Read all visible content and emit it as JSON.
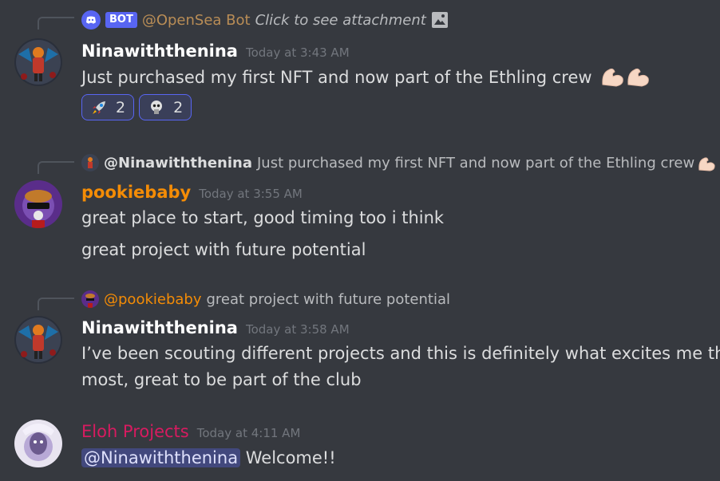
{
  "messages": [
    {
      "reply": {
        "bot_tag": "BOT",
        "author": "@OpenSea Bot",
        "text": "Click to see attachment"
      },
      "author": "Ninawiththenina",
      "timestamp": "Today at 3:43 AM",
      "lines": [
        "Just purchased my first NFT and now part of the Ethling crew"
      ],
      "reactions": [
        {
          "emoji": "rocket-icon",
          "count": "2"
        },
        {
          "emoji": "skull-avatar-icon",
          "count": "2"
        }
      ]
    },
    {
      "reply": {
        "author": "@Ninawiththenina",
        "text": "Just purchased my first NFT and now part of the Ethling crew",
        "ellipsis": "..."
      },
      "author": "pookiebaby",
      "timestamp": "Today at 3:55 AM",
      "lines": [
        "great place to start, good timing too i think",
        "great project with future potential"
      ]
    },
    {
      "reply": {
        "author": "@pookiebaby",
        "text": "great project with future potential"
      },
      "author": "Ninawiththenina",
      "timestamp": "Today at 3:58 AM",
      "lines": [
        "I’ve been scouting different projects and this is definitely what excites me the",
        "most, great to be part of the club"
      ]
    },
    {
      "author": "Eloh Projects",
      "timestamp": "Today at 4:11 AM",
      "mention": "@Ninawiththenina",
      "text": "Welcome!!"
    }
  ],
  "colors": {
    "background": "#36393f",
    "nina": "#ffffff",
    "pookie": "#f48c06",
    "eloh": "#d81b60",
    "timestamp": "#72767d",
    "blurple": "#5865f2",
    "bot_author": "#b98d56"
  }
}
